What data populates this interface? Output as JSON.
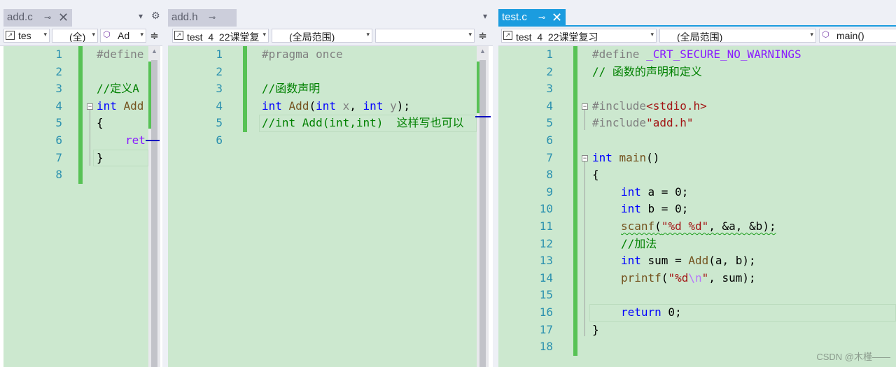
{
  "colors": {
    "editor_bg": "#cce8cf",
    "active_tab": "#1b9cdf",
    "keyword": "#0000ff",
    "comment": "#008000",
    "string": "#a31515",
    "line_number": "#2b91af",
    "change_bar": "#57c255"
  },
  "pane1": {
    "tab": {
      "name": "add.c",
      "pin": "⊸",
      "close": "✕"
    },
    "overflow_icon": "▾",
    "settings_icon": "⚙",
    "nav": {
      "project": "tes",
      "scope": "(全)",
      "member": "Ad"
    },
    "line_numbers": [
      "1",
      "2",
      "3",
      "4",
      "5",
      "6",
      "7",
      "8"
    ],
    "code": {
      "l1": "#define",
      "l3": "//定义A",
      "l4_kw": "int",
      "l4_fn": " Add",
      "l5": "{",
      "l6": "ret",
      "l7": "}"
    }
  },
  "pane2": {
    "tab": {
      "name": "add.h",
      "pin": "⊸"
    },
    "overflow_icon": "▾",
    "nav": {
      "project": "test_4_22课堂复",
      "scope": "(全局范围)",
      "member": ""
    },
    "line_numbers": [
      "1",
      "2",
      "3",
      "4",
      "5",
      "6"
    ],
    "code": {
      "l1": "#pragma once",
      "l3": "//函数声明",
      "l4": {
        "t1": "int",
        "t2": " ",
        "t3": "Add",
        "t4": "(",
        "t5": "int",
        "t6": " ",
        "t7": "x",
        "t8": ", ",
        "t9": "int",
        "t10": " ",
        "t11": "y",
        "t12": ");"
      },
      "l5": "//int Add(int,int)  这样写也可以"
    }
  },
  "pane3": {
    "tab": {
      "name": "test.c",
      "pin": "⊸",
      "close": "✕"
    },
    "nav": {
      "project": "test_4_22课堂复习",
      "scope": "(全局范围)",
      "member": "main()"
    },
    "line_numbers": [
      "1",
      "2",
      "3",
      "4",
      "5",
      "6",
      "7",
      "8",
      "9",
      "10",
      "11",
      "12",
      "13",
      "14",
      "15",
      "16",
      "17",
      "18"
    ],
    "code": {
      "l1": {
        "a": "#define ",
        "b": "_CRT_SECURE_NO_WARNINGS"
      },
      "l2": "// 函数的声明和定义",
      "l4": {
        "a": "#include",
        "b": "<stdio.h>"
      },
      "l5": {
        "a": "#include",
        "b": "\"add.h\""
      },
      "l7": {
        "a": "int",
        "b": " ",
        "c": "main",
        "d": "()"
      },
      "l8": "{",
      "l9": {
        "a": "int",
        "b": " a = 0;"
      },
      "l10": {
        "a": "int",
        "b": " b = 0;"
      },
      "l11": {
        "a": "scanf",
        "b": "(",
        "c": "\"%d %d\"",
        "d": ", &a, &b);"
      },
      "l12": "//加法",
      "l13": {
        "a": "int",
        "b": " sum = ",
        "c": "Add",
        "d": "(a, b);"
      },
      "l14": {
        "a": "printf",
        "b": "(",
        "c": "\"%d",
        "d": "\\n",
        "e": "\"",
        "f": ", sum);"
      },
      "l16": {
        "a": "return",
        "b": " 0;"
      },
      "l17": "}"
    }
  },
  "watermark": "CSDN @木槿——"
}
